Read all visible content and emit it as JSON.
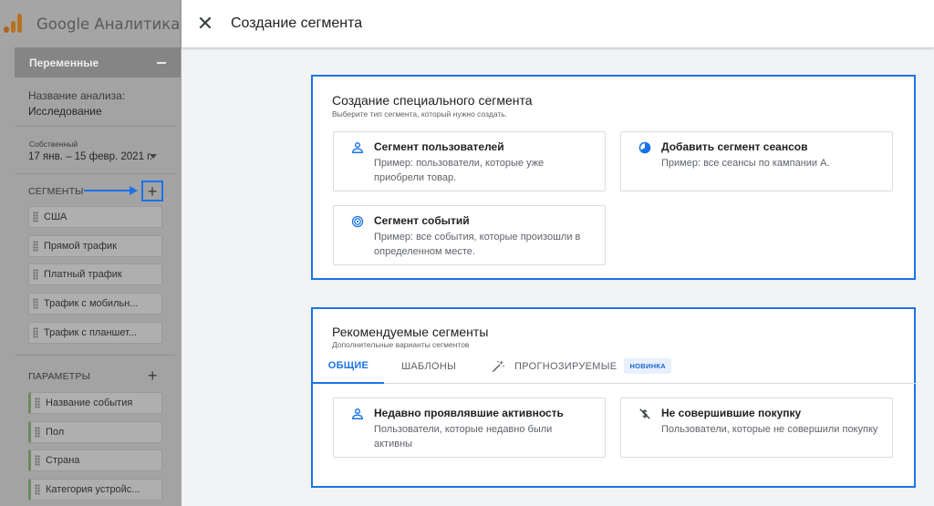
{
  "app": {
    "title": "Google Аналитика"
  },
  "sidebar": {
    "variables_label": "Переменные",
    "analysis_name_label": "Название анализа:",
    "analysis_name_value": "Исследование",
    "date_type": "Собственный",
    "date_range": "17 янв. – 15 февр. 2021 г.",
    "segments_label": "СЕГМЕНТЫ",
    "segments": [
      "США",
      "Прямой трафик",
      "Платный трафик",
      "Трафик с мобильн...",
      "Трафик с планшет..."
    ],
    "parameters_label": "ПАРАМЕТРЫ",
    "parameters": [
      "Название события",
      "Пол",
      "Страна",
      "Категория устройс..."
    ]
  },
  "header": {
    "close_icon": "close-icon",
    "title": "Создание сегмента"
  },
  "custom_segment": {
    "title": "Создание специального сегмента",
    "subtitle": "Выберите тип сегмента, который нужно создать.",
    "options": [
      {
        "icon": "person-icon",
        "title": "Сегмент пользователей",
        "description": "Пример: пользователи, которые уже приобрели товар."
      },
      {
        "icon": "session-icon",
        "title": "Добавить сегмент сеансов",
        "description": "Пример: все сеансы по кампании A."
      },
      {
        "icon": "event-icon",
        "title": "Сегмент событий",
        "description": "Пример: все события, которые произошли в определенном месте."
      }
    ]
  },
  "recommended": {
    "title": "Рекомендуемые сегменты",
    "subtitle": "Дополнительные варианты сегментов",
    "tabs": [
      {
        "label": "ОБЩИЕ",
        "active": true
      },
      {
        "label": "ШАБЛОНЫ",
        "active": false
      },
      {
        "label": "ПРОГНОЗИРУЕМЫЕ",
        "active": false,
        "icon": "magic-wand-icon",
        "badge": "НОВИНКА"
      }
    ],
    "options": [
      {
        "icon": "person-icon",
        "title": "Недавно проявлявшие активность",
        "description": "Пользователи, которые недавно были активны"
      },
      {
        "icon": "no-purchase-icon",
        "title": "Не совершившие покупку",
        "description": "Пользователи, которые не совершили покупку"
      }
    ]
  },
  "colors": {
    "accent": "#1a73e8",
    "overlay": "#8f8f8f",
    "panel_bg": "#f1f3f4"
  }
}
